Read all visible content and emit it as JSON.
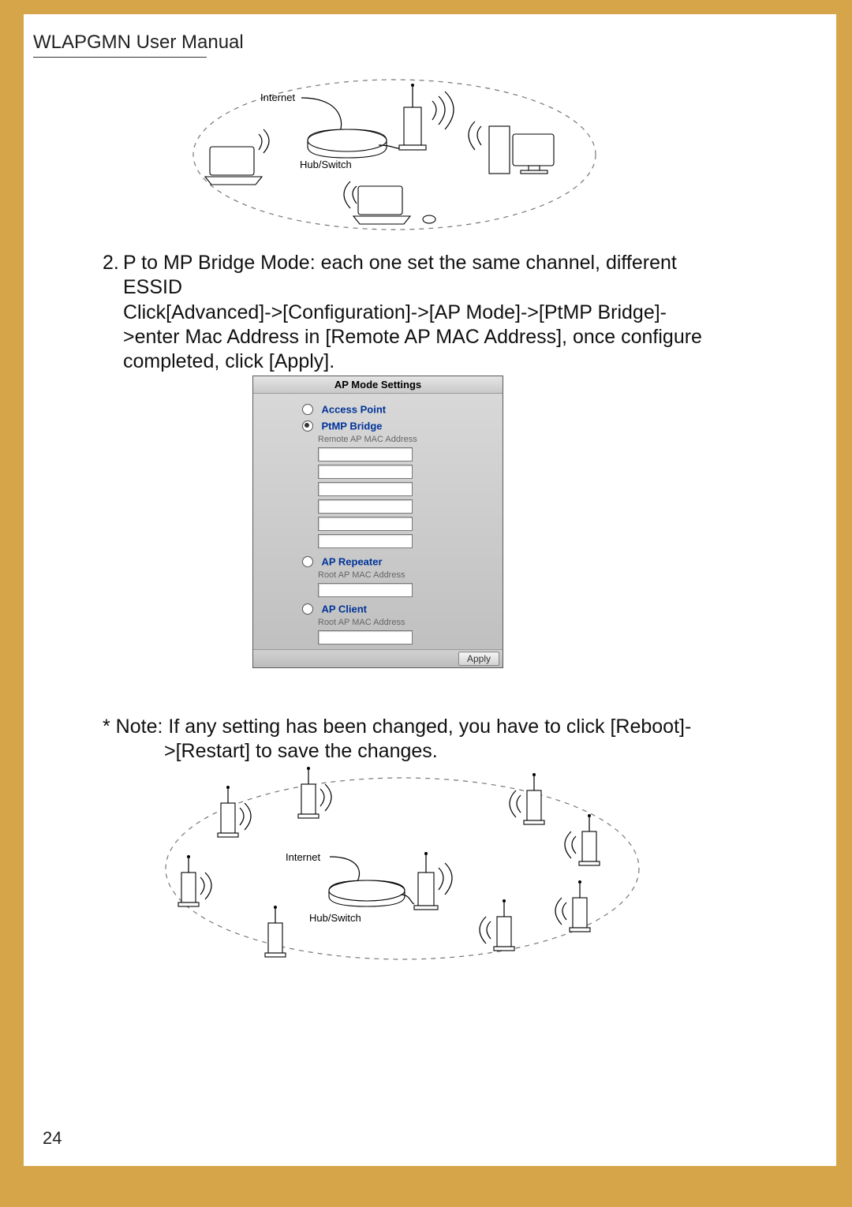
{
  "header": {
    "title": "WLAPGMN User Manual"
  },
  "diagram1": {
    "internet_label": "Internet",
    "hub_label": "Hub/Switch"
  },
  "step2": {
    "num": "2.",
    "line1": "P to MP Bridge Mode: each one set the same channel, different",
    "line2": "ESSID",
    "line3": "Click[Advanced]->[Configuration]->[AP Mode]->[PtMP Bridge]-",
    "line4": ">enter Mac Address in [Remote AP MAC Address], once configure",
    "line5": "completed, click [Apply]."
  },
  "panel": {
    "title": "AP Mode Settings",
    "opt_access_point": "Access Point",
    "opt_ptmp_bridge": "PtMP Bridge",
    "remote_mac_label": "Remote AP MAC Address",
    "opt_ap_repeater": "AP Repeater",
    "root_mac_label1": "Root AP MAC Address",
    "opt_ap_client": "AP Client",
    "root_mac_label2": "Root AP MAC Address",
    "apply": "Apply"
  },
  "note": {
    "line1": "* Note: If any setting has been changed, you have to click [Reboot]-",
    "line2": ">[Restart] to save the changes."
  },
  "diagram2": {
    "internet_label": "Internet",
    "hub_label": "Hub/Switch"
  },
  "page_number": "24"
}
